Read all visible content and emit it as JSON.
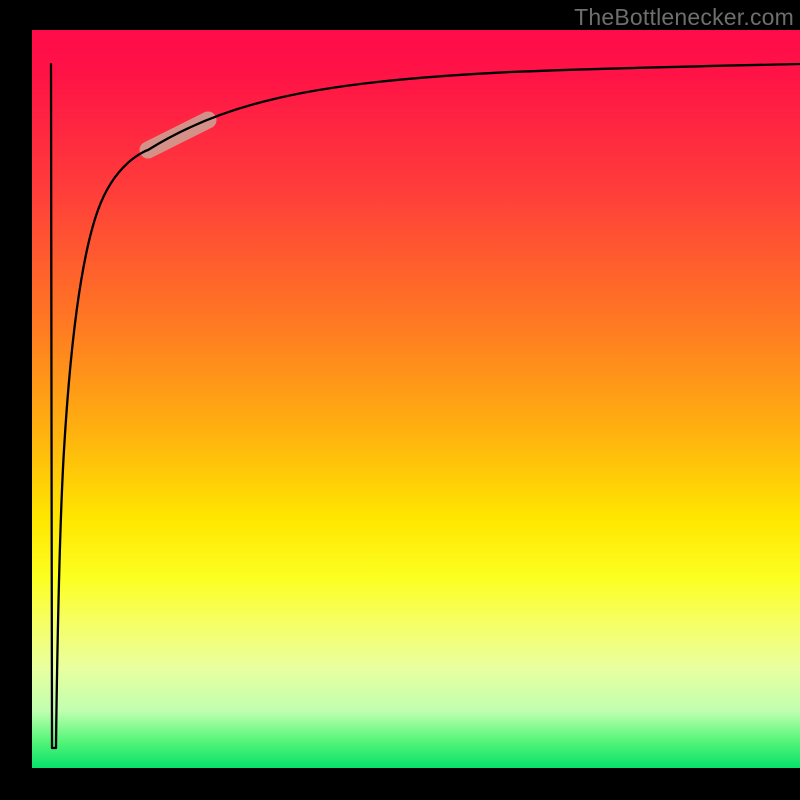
{
  "watermark": "TheBottlenecker.com",
  "chart_data": {
    "type": "line",
    "title": "",
    "xlabel": "",
    "ylabel": "",
    "xlim": [
      0,
      100
    ],
    "ylim": [
      0,
      100
    ],
    "series": [
      {
        "name": "curve",
        "x": [
          3.5,
          3.8,
          4.2,
          5.0,
          6.0,
          7.0,
          8.5,
          10.5,
          13.0,
          16.0,
          20.0,
          26.0,
          34.0,
          45.0,
          60.0,
          80.0,
          100.0
        ],
        "y": [
          2.0,
          30.0,
          50.0,
          63.0,
          72.0,
          77.0,
          82.0,
          85.5,
          88.0,
          89.8,
          91.2,
          92.3,
          93.0,
          93.6,
          94.1,
          94.5,
          94.8
        ]
      }
    ],
    "highlight": {
      "x_range": [
        16.0,
        25.0
      ],
      "y_range": [
        84.0,
        88.0
      ],
      "color": "#cf9a8e"
    },
    "background_gradient": {
      "top_color": "#ff0b4a",
      "mid_color": "#ffe600",
      "bottom_color": "#00e06a"
    }
  }
}
